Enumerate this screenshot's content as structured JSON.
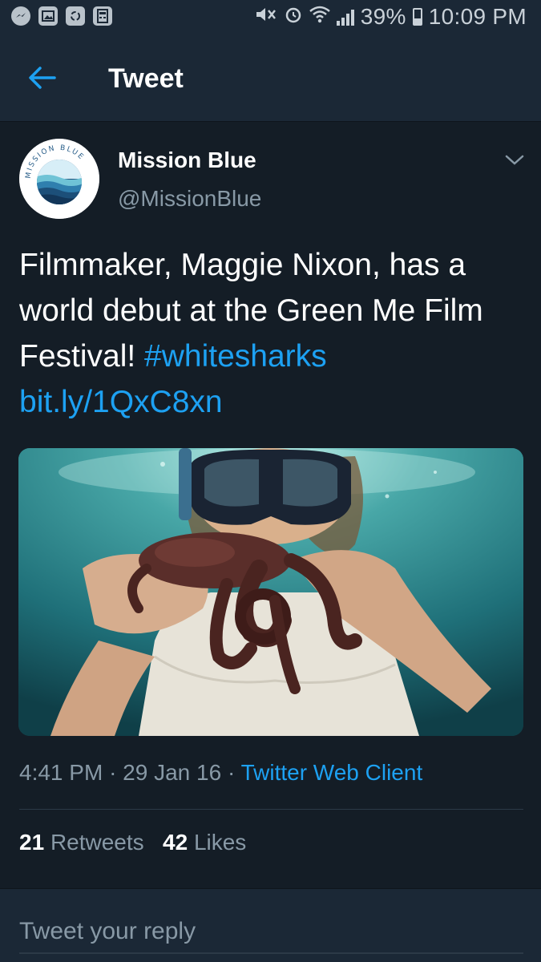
{
  "status_bar": {
    "percent": "39%",
    "time": "10:09 PM",
    "left_icons": [
      "messenger-icon",
      "gallery-icon",
      "recycle-icon",
      "calculator-icon"
    ],
    "right_icons": [
      "mute-icon",
      "alarm-icon",
      "wifi-icon",
      "signal-icon",
      "battery-icon"
    ],
    "battery_level": 0.39
  },
  "header": {
    "title": "Tweet",
    "back_icon": "arrow-left-icon"
  },
  "tweet": {
    "display_name": "Mission Blue",
    "handle": "@MissionBlue",
    "avatar_text": "MISSION BLUE",
    "text_main": "Filmmaker, Maggie Nixon, has a world debut at the Green Me Film Festival! ",
    "hashtag": "#whitesharks",
    "url": "bit.ly/1QxC8xn",
    "time": "4:41 PM",
    "date": "29 Jan 16",
    "separator": "·",
    "client": "Twitter Web Client",
    "retweets_count": "21",
    "retweets_label": "Retweets",
    "likes_count": "42",
    "likes_label": "Likes"
  },
  "reply": {
    "placeholder": "Tweet your reply"
  },
  "colors": {
    "background": "#141d26",
    "bar": "#1b2836",
    "accent": "#1da1f2",
    "muted": "#8899a6"
  }
}
